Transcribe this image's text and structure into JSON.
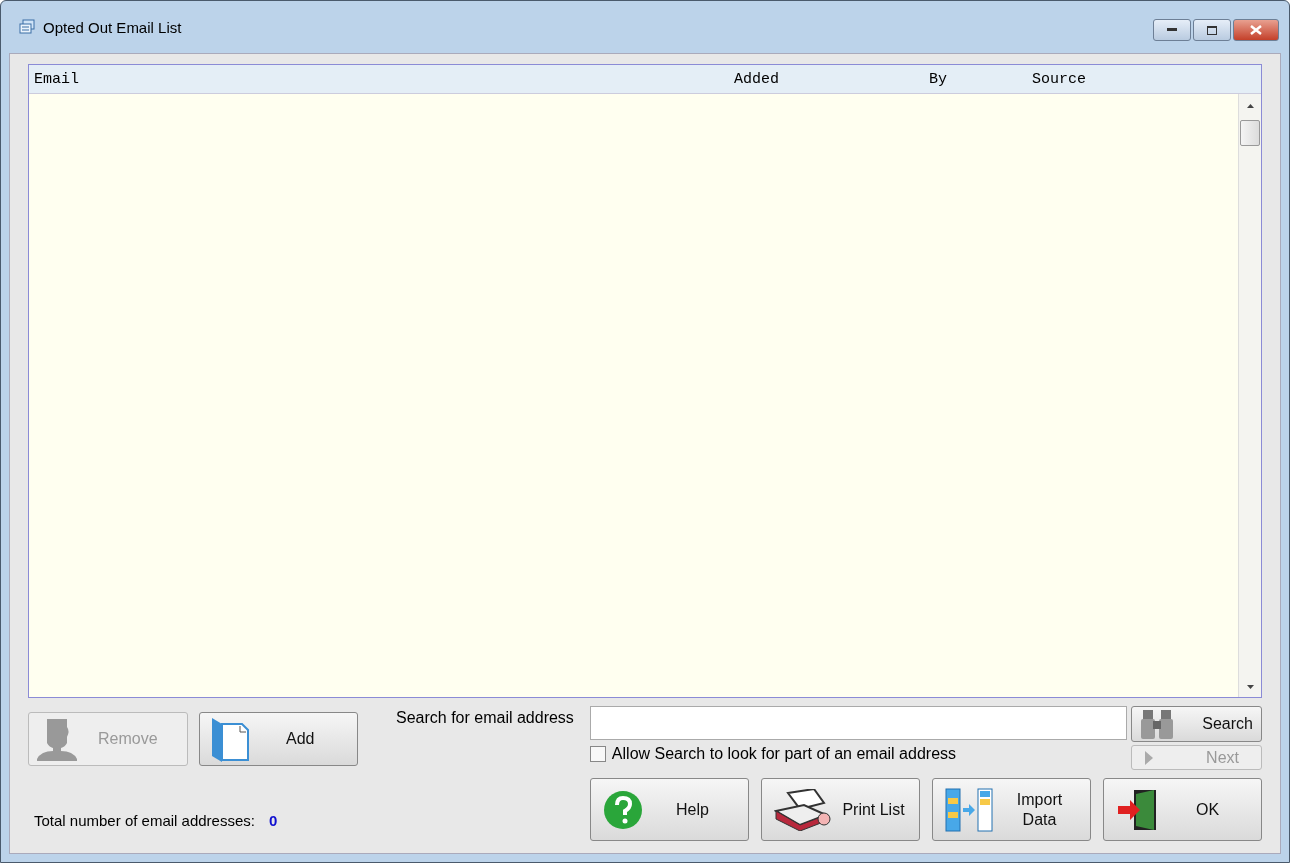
{
  "window": {
    "title": "Opted Out Email List"
  },
  "table": {
    "columns": [
      {
        "label": "Email"
      },
      {
        "label": "Added"
      },
      {
        "label": "By"
      },
      {
        "label": "Source"
      }
    ]
  },
  "edit_buttons": [
    {
      "kind": "remove",
      "label": "Remove",
      "disabled": true
    },
    {
      "kind": "add",
      "label": "Add",
      "disabled": false
    }
  ],
  "search": {
    "label": "Search for email address",
    "button": {
      "label": "Search",
      "disabled": false
    },
    "next": {
      "label": "Next",
      "disabled": true
    },
    "partial": {
      "label": "Allow Search to look for part of an email address",
      "checked": false
    }
  },
  "total": {
    "label": "Total number of email addresses:",
    "value": "0"
  },
  "actions": [
    {
      "kind": "help",
      "label": "Help"
    },
    {
      "kind": "print",
      "label": "Print List"
    },
    {
      "kind": "import",
      "label": "Import Data"
    },
    {
      "kind": "ok",
      "label": "OK"
    }
  ]
}
